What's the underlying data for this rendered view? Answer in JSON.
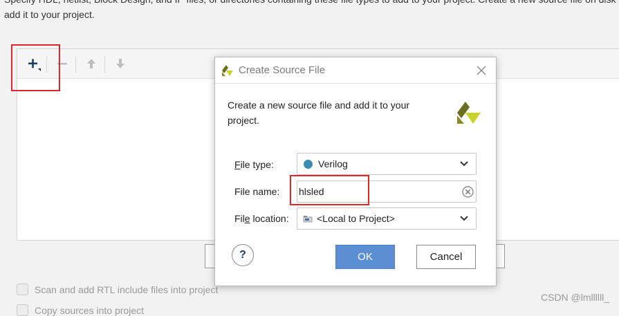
{
  "background": {
    "intro_line1": "Specify HDL, netlist, Block Design, and IP files, or directories containing these file types to add to your project. Create a new source file on disk and",
    "intro_line2": "add it to your project.",
    "toolbar": {
      "add_icon": "plus-icon",
      "remove_icon": "minus-icon",
      "up_icon": "arrow-up-icon",
      "down_icon": "arrow-down-icon"
    },
    "checkboxes": [
      {
        "label": "Scan and add RTL include files into project",
        "checked": false
      },
      {
        "label": "Copy sources into project",
        "checked": false
      }
    ]
  },
  "dialog": {
    "title": "Create Source File",
    "description": "Create a new source file and add it to your project.",
    "file_type": {
      "label_prefix": "F",
      "label_rest": "ile type:",
      "value": "Verilog",
      "dot_color": "#3b8bb3"
    },
    "file_name": {
      "label": "File name:",
      "value": "hlsled"
    },
    "file_location": {
      "label_prefix": "Fil",
      "label_mnemonic": "e",
      "label_rest": " location:",
      "value": "<Local to Project>"
    },
    "help_label": "?",
    "ok_label": "OK",
    "cancel_label": "Cancel"
  },
  "colors": {
    "highlight": "#e0262b",
    "ok_button": "#5b8ed3",
    "logo_dark": "#6b6d1f",
    "logo_light": "#c8d22a"
  },
  "watermark": "CSDN @lmllllll_"
}
